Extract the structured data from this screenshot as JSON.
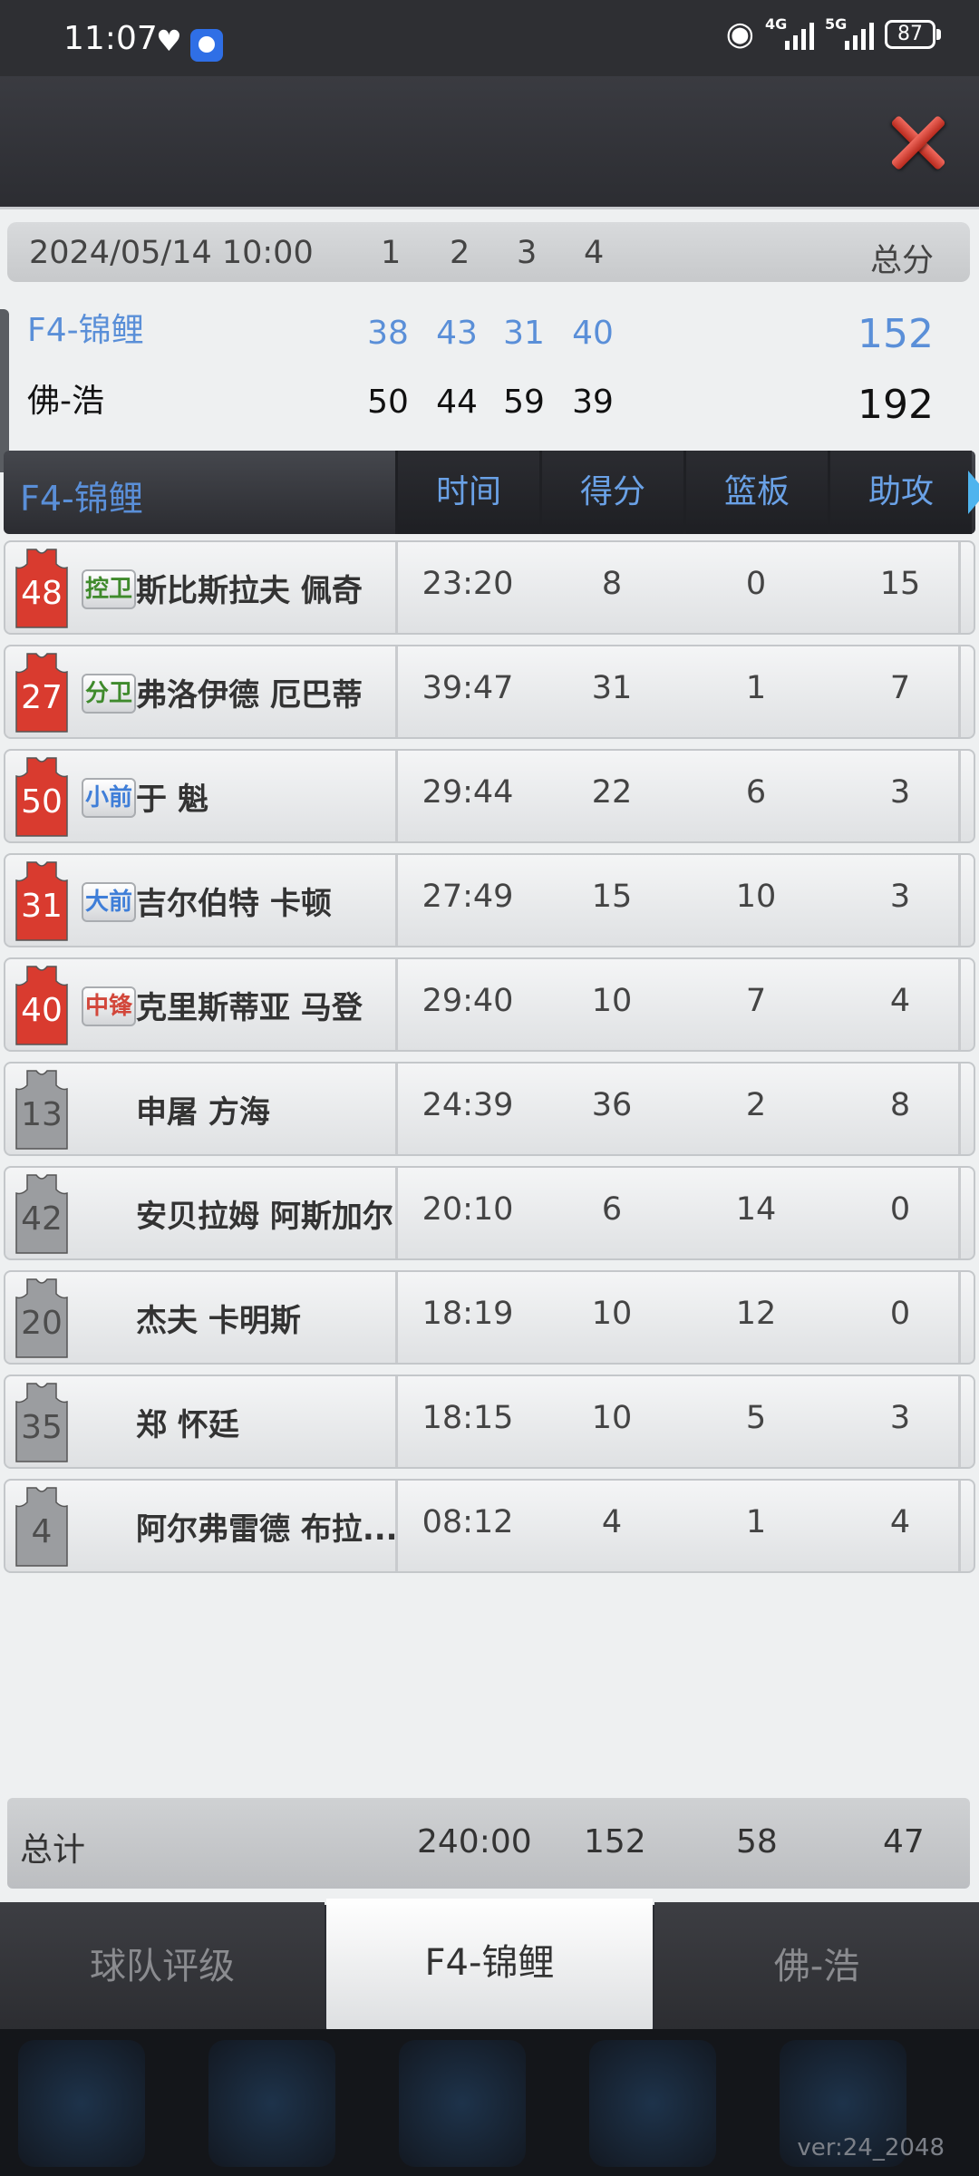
{
  "status_bar": {
    "time": "11:07",
    "network_1": "4G",
    "network_2": "5G",
    "battery": "87",
    "icons": [
      "heart-icon",
      "app-icon",
      "eye-icon",
      "signal-icon",
      "battery-icon"
    ]
  },
  "dialog": {
    "close_icon": "close-icon"
  },
  "scoreboard": {
    "datetime": "2024/05/14 10:00",
    "quarters": [
      "1",
      "2",
      "3",
      "4"
    ],
    "total_label": "总分",
    "teams": [
      {
        "name": "F4-锦鲤",
        "quarters": [
          "38",
          "43",
          "31",
          "40"
        ],
        "total": "152",
        "color": "#5a8fd8"
      },
      {
        "name": "佛-浩",
        "quarters": [
          "50",
          "44",
          "59",
          "39"
        ],
        "total": "192",
        "color": "#111111"
      }
    ]
  },
  "table": {
    "team_label": "F4-锦鲤",
    "columns": [
      "时间",
      "得分",
      "篮板",
      "助攻"
    ],
    "rows": [
      {
        "number": "48",
        "starter": true,
        "position": "控卫",
        "pos_color": "#3f8a2c",
        "name": "斯比斯拉夫 佩奇",
        "time": "23:20",
        "points": "8",
        "rebounds": "0",
        "assists": "15"
      },
      {
        "number": "27",
        "starter": true,
        "position": "分卫",
        "pos_color": "#3f8a2c",
        "name": "弗洛伊德 厄巴蒂",
        "time": "39:47",
        "points": "31",
        "rebounds": "1",
        "assists": "7"
      },
      {
        "number": "50",
        "starter": true,
        "position": "小前",
        "pos_color": "#3f7ed8",
        "name": "于 魁",
        "time": "29:44",
        "points": "22",
        "rebounds": "6",
        "assists": "3"
      },
      {
        "number": "31",
        "starter": true,
        "position": "大前",
        "pos_color": "#3f7ed8",
        "name": "吉尔伯特 卡顿",
        "time": "27:49",
        "points": "15",
        "rebounds": "10",
        "assists": "3"
      },
      {
        "number": "40",
        "starter": true,
        "position": "中锋",
        "pos_color": "#d2473b",
        "name": "克里斯蒂亚 马登",
        "time": "29:40",
        "points": "10",
        "rebounds": "7",
        "assists": "4"
      },
      {
        "number": "13",
        "starter": false,
        "position": "",
        "pos_color": "",
        "name": "申屠 方海",
        "time": "24:39",
        "points": "36",
        "rebounds": "2",
        "assists": "8"
      },
      {
        "number": "42",
        "starter": false,
        "position": "",
        "pos_color": "",
        "name": "安贝拉姆 阿斯加尔",
        "time": "20:10",
        "points": "6",
        "rebounds": "14",
        "assists": "0"
      },
      {
        "number": "20",
        "starter": false,
        "position": "",
        "pos_color": "",
        "name": "杰夫 卡明斯",
        "time": "18:19",
        "points": "10",
        "rebounds": "12",
        "assists": "0"
      },
      {
        "number": "35",
        "starter": false,
        "position": "",
        "pos_color": "",
        "name": "郑 怀廷",
        "time": "18:15",
        "points": "10",
        "rebounds": "5",
        "assists": "3"
      },
      {
        "number": "4",
        "starter": false,
        "position": "",
        "pos_color": "",
        "name": "阿尔弗雷德 布拉...",
        "time": "08:12",
        "points": "4",
        "rebounds": "1",
        "assists": "4"
      }
    ],
    "total": {
      "label": "总计",
      "time": "240:00",
      "points": "152",
      "rebounds": "58",
      "assists": "47"
    }
  },
  "tabs": [
    {
      "label": "球队评级",
      "active": false
    },
    {
      "label": "F4-锦鲤",
      "active": true
    },
    {
      "label": "佛-浩",
      "active": false
    }
  ],
  "footer": {
    "version": "ver:24_2048"
  },
  "colors": {
    "accent_blue": "#5a8fd8",
    "jersey_red": "#d93b2f",
    "jersey_grey": "#9b9da0",
    "close_red": "#d8392c"
  }
}
